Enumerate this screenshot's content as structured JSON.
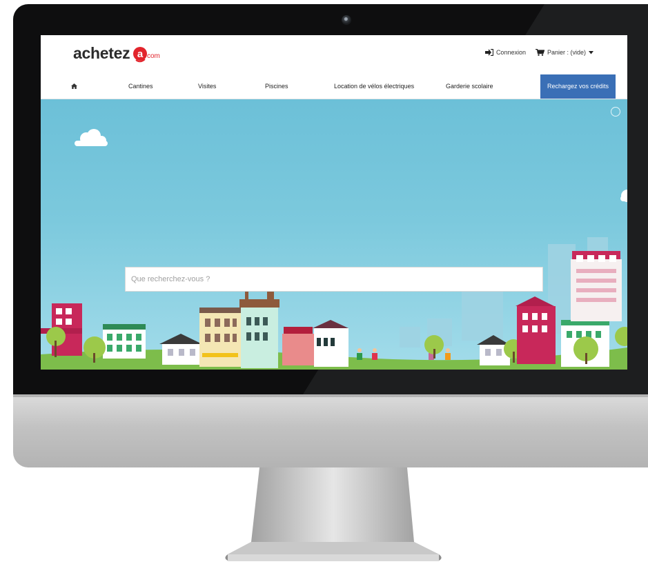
{
  "brand": {
    "logo_text": "achetez",
    "logo_accent": "com",
    "accent_color": "#e2242c"
  },
  "header": {
    "connexion_label": "Connexion",
    "cart_label": "Panier : (vide)"
  },
  "nav": {
    "home_icon": "home-icon",
    "items": [
      {
        "label": "Cantines"
      },
      {
        "label": "Visites"
      },
      {
        "label": "Piscines"
      },
      {
        "label": "Location de vélos électriques"
      },
      {
        "label": "Garderie scolaire"
      }
    ],
    "cta_label": "Rechargez vos crédits",
    "cta_color": "#3a6fb6"
  },
  "hero": {
    "search_placeholder": "Que recherchez-vous ?",
    "sky_color": "#6cc0d8"
  }
}
